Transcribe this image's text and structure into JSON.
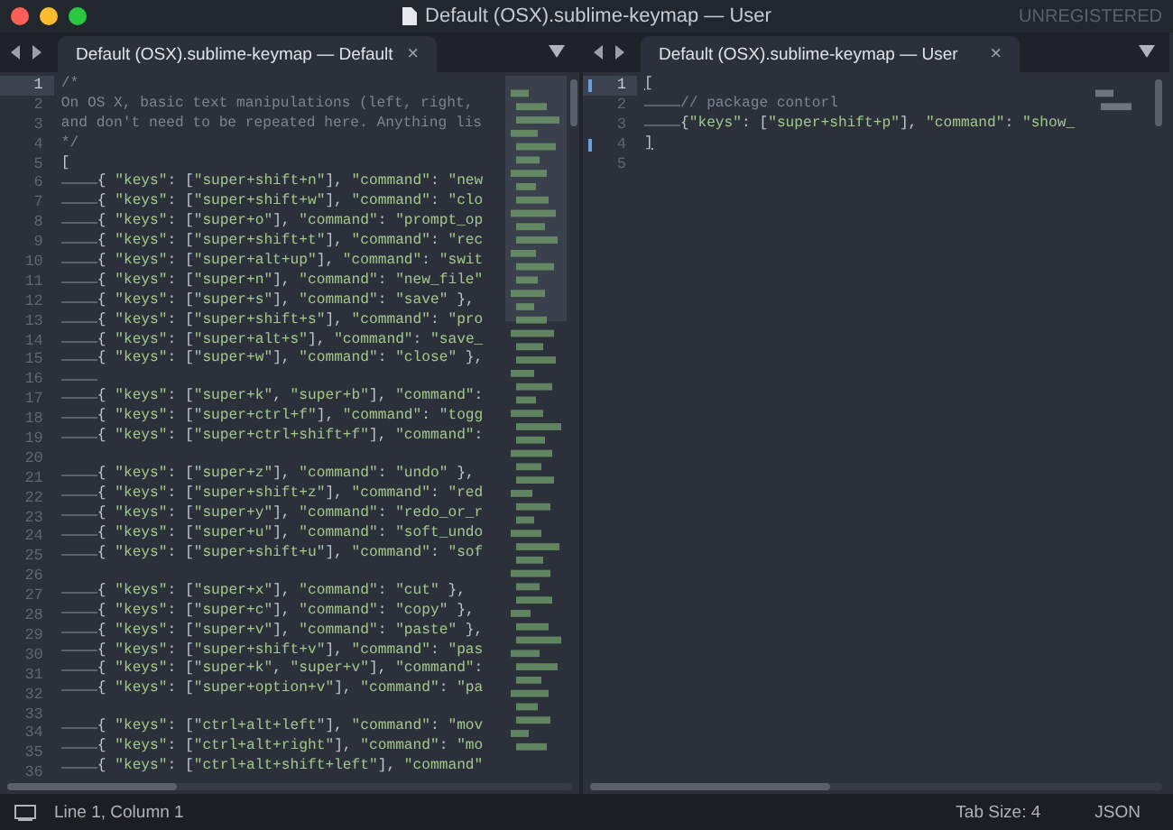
{
  "window": {
    "title": "Default (OSX).sublime-keymap — User",
    "license": "UNREGISTERED"
  },
  "panes": [
    {
      "tab": {
        "label": "Default (OSX).sublime-keymap — Default",
        "close": "×",
        "selected": true
      },
      "lines": [
        {
          "n": "1",
          "text": "/*",
          "kind": "comment",
          "indented": false,
          "current": true,
          "bracket_mark": false
        },
        {
          "n": "2",
          "text": "On OS X, basic text manipulations (left, right,",
          "kind": "comment",
          "indented": false,
          "current": false,
          "bracket_mark": false
        },
        {
          "n": "3",
          "text": "and don't need to be repeated here. Anything lis",
          "kind": "comment",
          "indented": false,
          "current": false,
          "bracket_mark": false
        },
        {
          "n": "4",
          "text": "*/",
          "kind": "comment",
          "indented": false,
          "current": false,
          "bracket_mark": false
        },
        {
          "n": "5",
          "text": "[",
          "kind": "code",
          "indented": false,
          "current": false,
          "bracket_mark": false
        },
        {
          "n": "6",
          "text": "{ \"keys\": [\"super+shift+n\"], \"command\": \"new",
          "kind": "code",
          "indented": true,
          "current": false,
          "bracket_mark": false
        },
        {
          "n": "7",
          "text": "{ \"keys\": [\"super+shift+w\"], \"command\": \"clo",
          "kind": "code",
          "indented": true,
          "current": false,
          "bracket_mark": false
        },
        {
          "n": "8",
          "text": "{ \"keys\": [\"super+o\"], \"command\": \"prompt_op",
          "kind": "code",
          "indented": true,
          "current": false,
          "bracket_mark": false
        },
        {
          "n": "9",
          "text": "{ \"keys\": [\"super+shift+t\"], \"command\": \"rec",
          "kind": "code",
          "indented": true,
          "current": false,
          "bracket_mark": false
        },
        {
          "n": "10",
          "text": "{ \"keys\": [\"super+alt+up\"], \"command\": \"swit",
          "kind": "code",
          "indented": true,
          "current": false,
          "bracket_mark": false
        },
        {
          "n": "11",
          "text": "{ \"keys\": [\"super+n\"], \"command\": \"new_file\"",
          "kind": "code",
          "indented": true,
          "current": false,
          "bracket_mark": false
        },
        {
          "n": "12",
          "text": "{ \"keys\": [\"super+s\"], \"command\": \"save\" },",
          "kind": "code",
          "indented": true,
          "current": false,
          "bracket_mark": false
        },
        {
          "n": "13",
          "text": "{ \"keys\": [\"super+shift+s\"], \"command\": \"pro",
          "kind": "code",
          "indented": true,
          "current": false,
          "bracket_mark": false
        },
        {
          "n": "14",
          "text": "{ \"keys\": [\"super+alt+s\"], \"command\": \"save_",
          "kind": "code",
          "indented": true,
          "current": false,
          "bracket_mark": false
        },
        {
          "n": "15",
          "text": "{ \"keys\": [\"super+w\"], \"command\": \"close\" },",
          "kind": "code",
          "indented": true,
          "current": false,
          "bracket_mark": false
        },
        {
          "n": "16",
          "kind": "code",
          "indented": true,
          "current": false,
          "bracket_mark": false
        },
        {
          "n": "17",
          "text": "{ \"keys\": [\"super+k\", \"super+b\"], \"command\":",
          "kind": "code",
          "indented": true,
          "current": false,
          "bracket_mark": false
        },
        {
          "n": "18",
          "text": "{ \"keys\": [\"super+ctrl+f\"], \"command\": \"togg",
          "kind": "code",
          "indented": true,
          "current": false,
          "bracket_mark": false
        },
        {
          "n": "19",
          "text": "{ \"keys\": [\"super+ctrl+shift+f\"], \"command\":",
          "kind": "code",
          "indented": true,
          "current": false,
          "bracket_mark": false
        },
        {
          "n": "20",
          "kind": "code",
          "indented": false,
          "current": false,
          "bracket_mark": false
        },
        {
          "n": "21",
          "text": "{ \"keys\": [\"super+z\"], \"command\": \"undo\" },",
          "kind": "code",
          "indented": true,
          "current": false,
          "bracket_mark": false
        },
        {
          "n": "22",
          "text": "{ \"keys\": [\"super+shift+z\"], \"command\": \"red",
          "kind": "code",
          "indented": true,
          "current": false,
          "bracket_mark": false
        },
        {
          "n": "23",
          "text": "{ \"keys\": [\"super+y\"], \"command\": \"redo_or_r",
          "kind": "code",
          "indented": true,
          "current": false,
          "bracket_mark": false
        },
        {
          "n": "24",
          "text": "{ \"keys\": [\"super+u\"], \"command\": \"soft_undo",
          "kind": "code",
          "indented": true,
          "current": false,
          "bracket_mark": false
        },
        {
          "n": "25",
          "text": "{ \"keys\": [\"super+shift+u\"], \"command\": \"sof",
          "kind": "code",
          "indented": true,
          "current": false,
          "bracket_mark": false
        },
        {
          "n": "26",
          "kind": "code",
          "indented": false,
          "current": false,
          "bracket_mark": false
        },
        {
          "n": "27",
          "text": "{ \"keys\": [\"super+x\"], \"command\": \"cut\" },",
          "kind": "code",
          "indented": true,
          "current": false,
          "bracket_mark": false
        },
        {
          "n": "28",
          "text": "{ \"keys\": [\"super+c\"], \"command\": \"copy\" },",
          "kind": "code",
          "indented": true,
          "current": false,
          "bracket_mark": false
        },
        {
          "n": "29",
          "text": "{ \"keys\": [\"super+v\"], \"command\": \"paste\" },",
          "kind": "code",
          "indented": true,
          "current": false,
          "bracket_mark": false
        },
        {
          "n": "30",
          "text": "{ \"keys\": [\"super+shift+v\"], \"command\": \"pas",
          "kind": "code",
          "indented": true,
          "current": false,
          "bracket_mark": false
        },
        {
          "n": "31",
          "text": "{ \"keys\": [\"super+k\", \"super+v\"], \"command\":",
          "kind": "code",
          "indented": true,
          "current": false,
          "bracket_mark": false
        },
        {
          "n": "32",
          "text": "{ \"keys\": [\"super+option+v\"], \"command\": \"pa",
          "kind": "code",
          "indented": true,
          "current": false,
          "bracket_mark": false
        },
        {
          "n": "33",
          "kind": "code",
          "indented": false,
          "current": false,
          "bracket_mark": false
        },
        {
          "n": "34",
          "text": "{ \"keys\": [\"ctrl+alt+left\"], \"command\": \"mov",
          "kind": "code",
          "indented": true,
          "current": false,
          "bracket_mark": false
        },
        {
          "n": "35",
          "text": "{ \"keys\": [\"ctrl+alt+right\"], \"command\": \"mo",
          "kind": "code",
          "indented": true,
          "current": false,
          "bracket_mark": false
        },
        {
          "n": "36",
          "text": "{ \"keys\": [\"ctrl+alt+shift+left\"], \"command\"",
          "kind": "code",
          "indented": true,
          "current": false,
          "bracket_mark": false
        }
      ]
    },
    {
      "tab": {
        "label": "Default (OSX).sublime-keymap — User",
        "close": "×",
        "selected": true
      },
      "lines": [
        {
          "n": "1",
          "text": "[",
          "kind": "code",
          "indented": false,
          "current": true,
          "bracket_mark": true
        },
        {
          "n": "2",
          "text": "// package contorl",
          "kind": "comment",
          "indented": true,
          "current": false,
          "bracket_mark": false
        },
        {
          "n": "3",
          "text": "{\"keys\": [\"super+shift+p\"], \"command\": \"show_",
          "kind": "code",
          "indented": true,
          "current": false,
          "bracket_mark": false
        },
        {
          "n": "4",
          "text": "]",
          "kind": "code",
          "indented": false,
          "current": false,
          "bracket_mark": true
        },
        {
          "n": "5",
          "kind": "code",
          "indented": false,
          "current": false,
          "bracket_mark": false
        }
      ]
    }
  ],
  "status_bar": {
    "position": "Line 1, Column 1",
    "tab_size": "Tab Size: 4",
    "syntax": "JSON"
  }
}
